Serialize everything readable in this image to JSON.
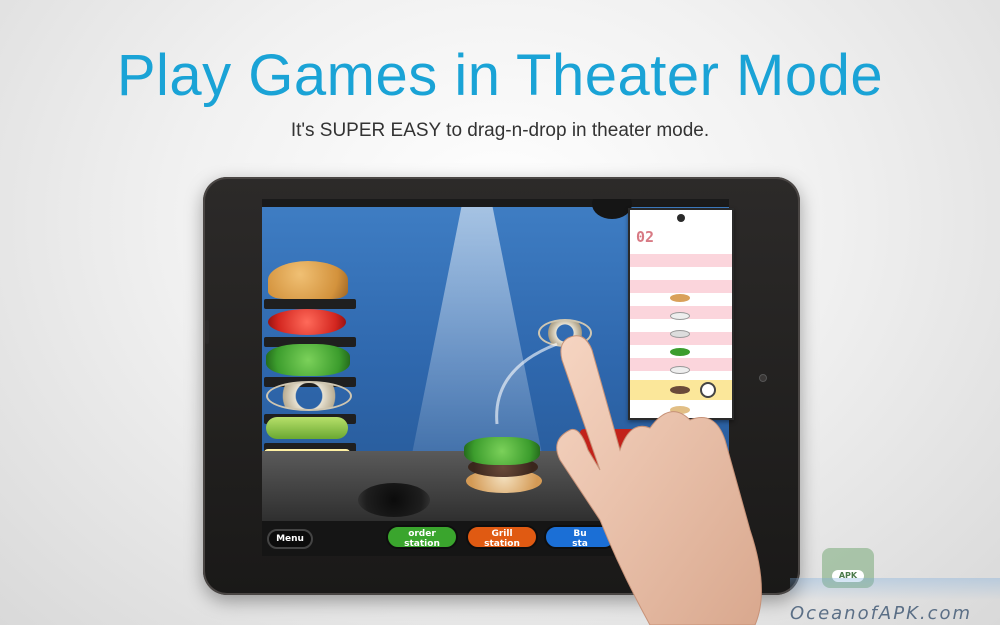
{
  "header": {
    "title": "Play Games in Theater Mode",
    "subtitle": "It's SUPER EASY to drag-n-drop in theater mode."
  },
  "game": {
    "menu_label": "Menu",
    "stations": [
      {
        "line1": "order",
        "line2": "station",
        "color": "#3aa52d"
      },
      {
        "line1": "Grill",
        "line2": "station",
        "color": "#e05a12"
      },
      {
        "line1": "Bu",
        "line2": "sta",
        "color": "#1b6fd6"
      }
    ],
    "ticket": {
      "number": "02"
    }
  },
  "watermark": {
    "badge": "APK",
    "site": "OceanofAPK.com"
  },
  "colors": {
    "accent": "#1aa3d6",
    "screen_bg": "#3f7ec4",
    "ticket_stripe": "#fbd5dc"
  }
}
